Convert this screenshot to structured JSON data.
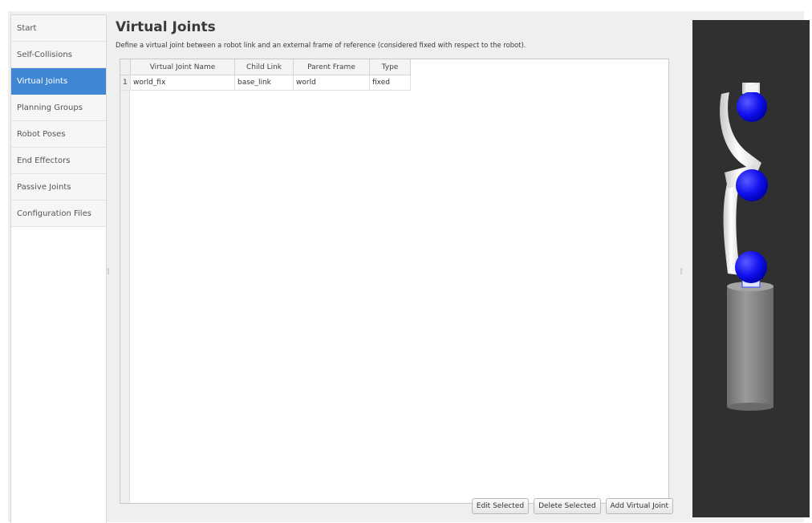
{
  "sidebar": {
    "items": [
      {
        "label": "Start"
      },
      {
        "label": "Self-Collisions"
      },
      {
        "label": "Virtual Joints",
        "active": true
      },
      {
        "label": "Planning Groups"
      },
      {
        "label": "Robot Poses"
      },
      {
        "label": "End Effectors"
      },
      {
        "label": "Passive Joints"
      },
      {
        "label": "Configuration Files"
      }
    ]
  },
  "main": {
    "title": "Virtual Joints",
    "description": "Define a virtual joint between a robot link and an external frame of reference (considered fixed with respect to the robot).",
    "table": {
      "headers": [
        "Virtual Joint Name",
        "Child Link",
        "Parent Frame",
        "Type"
      ],
      "rows": [
        {
          "index": "1",
          "cells": [
            "world_fix",
            "base_link",
            "world",
            "fixed"
          ]
        }
      ]
    },
    "buttons": {
      "edit": "Edit Selected",
      "delete": "Delete Selected",
      "add": "Add Virtual Joint"
    }
  },
  "viewer": {
    "background": "#303030",
    "joint_color": "#1a1aff",
    "link_color": "#f0f0f0",
    "base_color": "#8a8a8a"
  }
}
